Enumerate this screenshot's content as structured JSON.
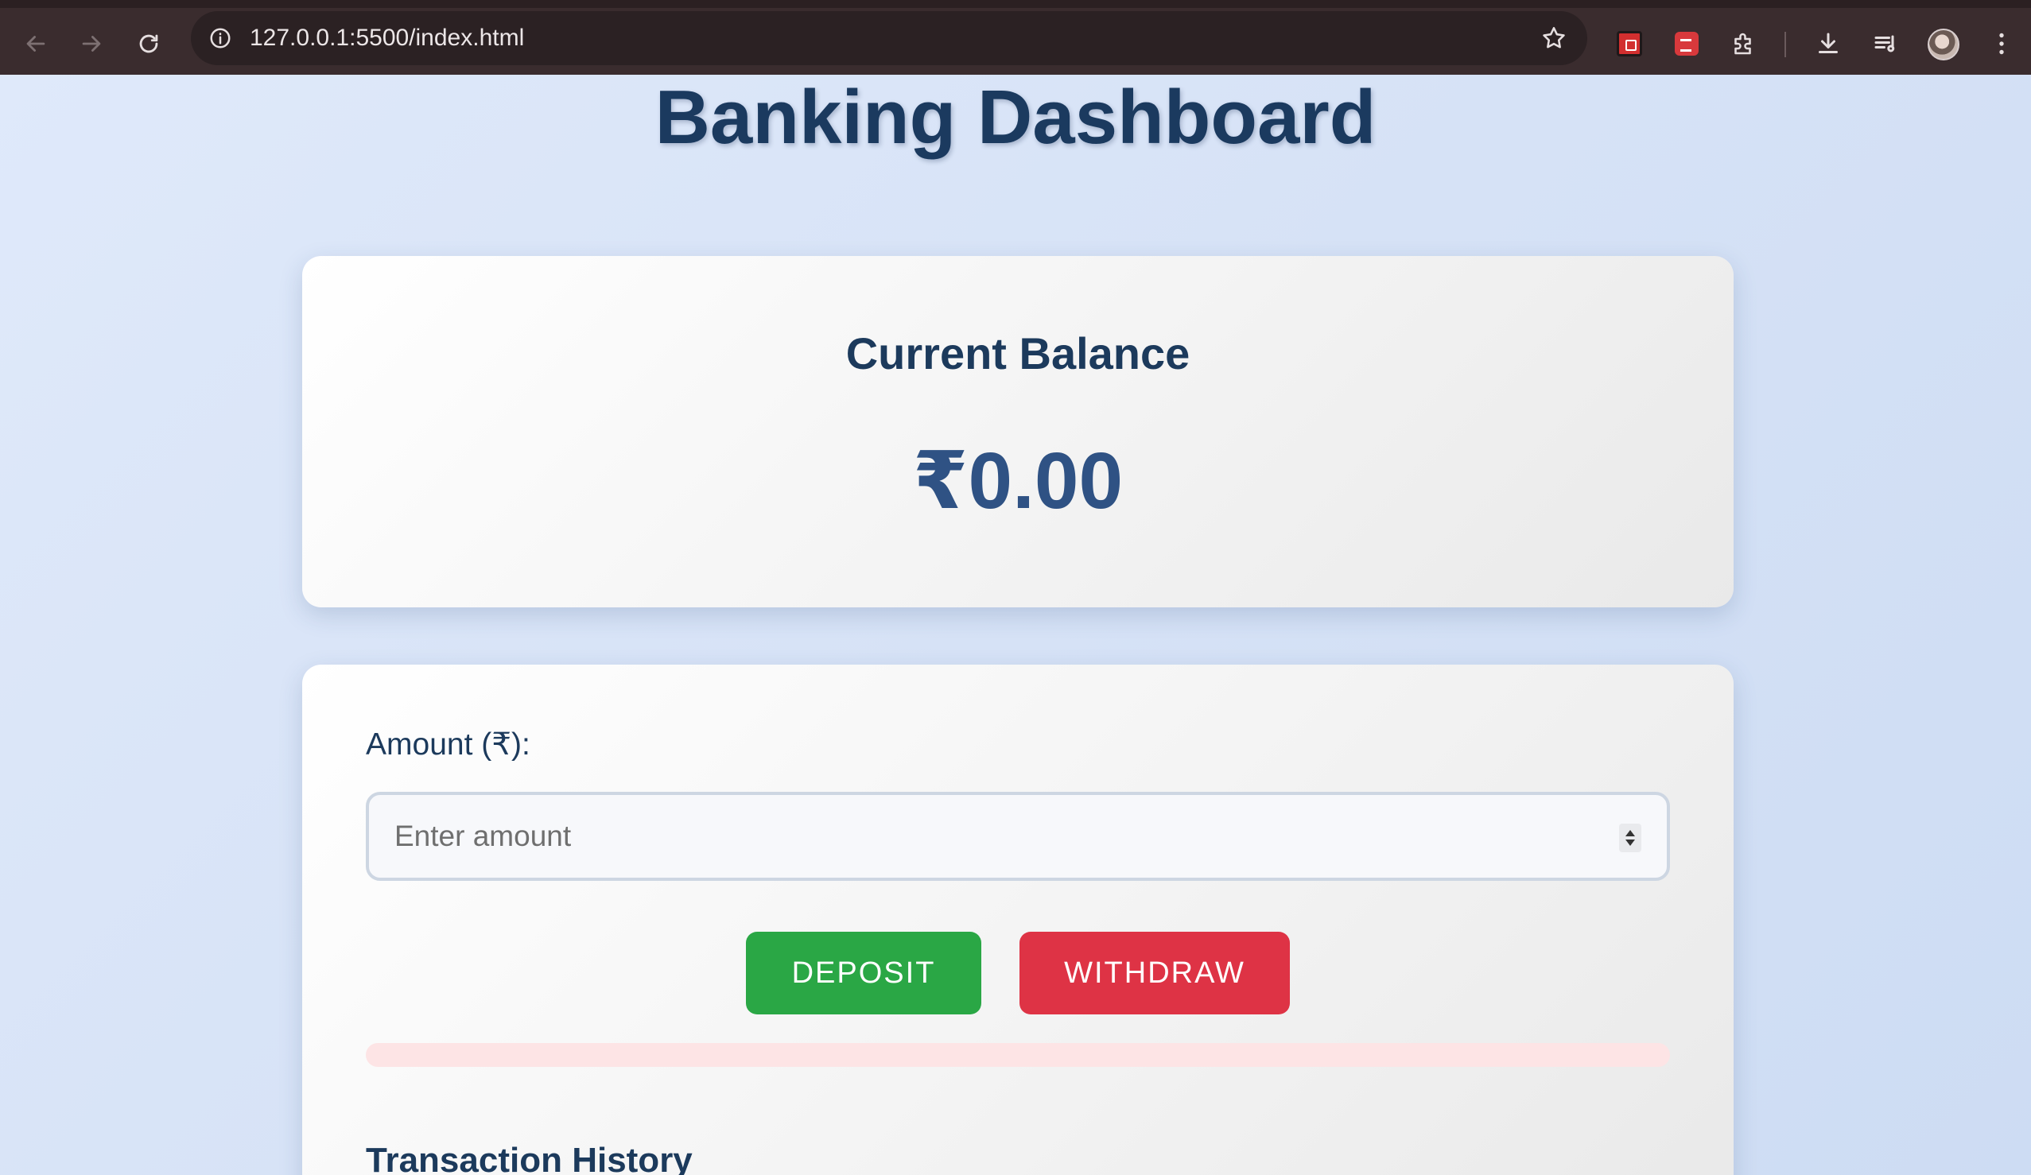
{
  "browser": {
    "url": "127.0.0.1:5500/index.html",
    "icons": [
      "back-arrow-icon",
      "forward-arrow-icon",
      "reload-icon",
      "site-info-icon",
      "bookmark-star-icon",
      "extension-icon",
      "download-icon",
      "reading-list-icon",
      "profile-avatar",
      "more-menu-icon"
    ]
  },
  "page": {
    "title": "Banking Dashboard"
  },
  "balance": {
    "title": "Current Balance",
    "value": "₹0.00"
  },
  "form": {
    "amount_label": "Amount (₹):",
    "amount_placeholder": "Enter amount",
    "amount_value": "",
    "deposit_label": "DEPOSIT",
    "withdraw_label": "WITHDRAW",
    "message": ""
  },
  "history": {
    "title": "Transaction History"
  },
  "colors": {
    "deposit": "#2aa745",
    "withdraw": "#de3345",
    "heading": "#1c3a5c",
    "balance": "#2f5284"
  }
}
